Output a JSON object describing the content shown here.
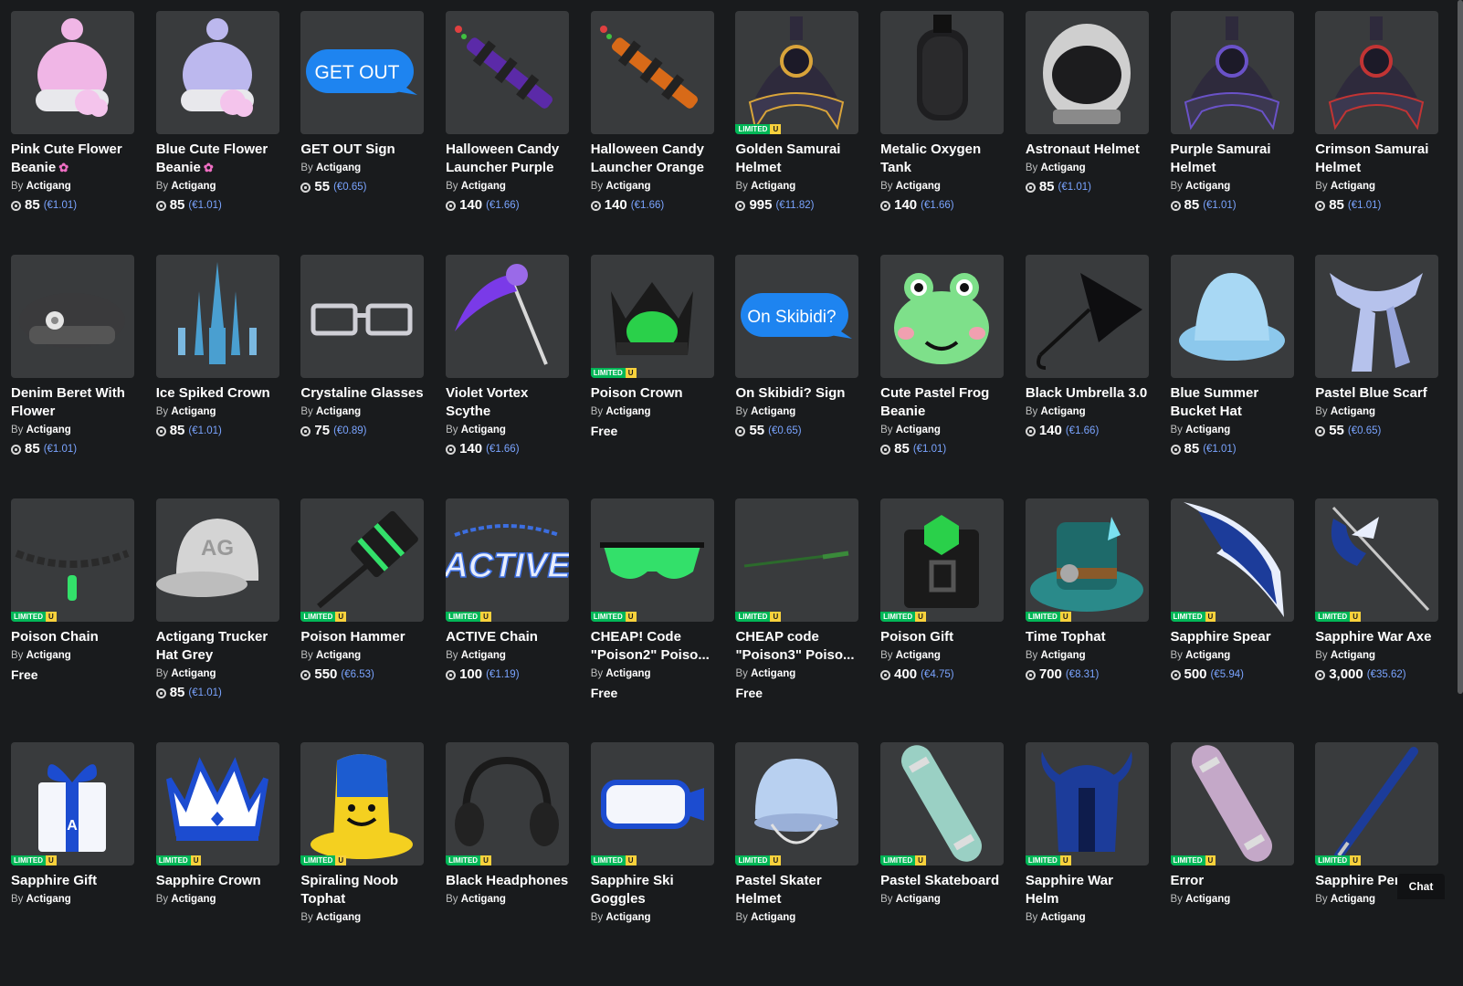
{
  "chat_label": "Chat",
  "creator_prefix": "By",
  "limited_label": "LIMITED",
  "unique_label": "U",
  "rows": [
    [
      {
        "name": "Pink Cute Flower Beanie",
        "flower": true,
        "creator": "Actigang",
        "price": "85",
        "eur": "(€1.01)",
        "limited": false,
        "icon": "pink-beanie-icon",
        "art": "beanie",
        "color": "#f0b6e6"
      },
      {
        "name": "Blue Cute Flower Beanie",
        "flower": true,
        "creator": "Actigang",
        "price": "85",
        "eur": "(€1.01)",
        "limited": false,
        "icon": "blue-beanie-icon",
        "art": "beanie",
        "color": "#bcb8ee"
      },
      {
        "name": "GET OUT Sign",
        "creator": "Actigang",
        "price": "55",
        "eur": "(€0.65)",
        "limited": false,
        "icon": "get-out-sign-icon",
        "art": "bubble",
        "bubble_text": "GET OUT"
      },
      {
        "name": "Halloween Candy Launcher Purple",
        "creator": "Actigang",
        "price": "140",
        "eur": "(€1.66)",
        "limited": false,
        "icon": "purple-launcher-icon",
        "art": "launcher",
        "color": "#5b2aa8"
      },
      {
        "name": "Halloween Candy Launcher Orange",
        "creator": "Actigang",
        "price": "140",
        "eur": "(€1.66)",
        "limited": false,
        "icon": "orange-launcher-icon",
        "art": "launcher",
        "color": "#d86a18"
      },
      {
        "name": "Golden Samurai Helmet",
        "creator": "Actigang",
        "price": "995",
        "eur": "(€11.82)",
        "limited": true,
        "icon": "golden-samurai-helmet-icon",
        "art": "samurai",
        "color": "#d9a43a"
      },
      {
        "name": "Metalic Oxygen Tank",
        "creator": "Actigang",
        "price": "140",
        "eur": "(€1.66)",
        "limited": false,
        "icon": "oxygen-tank-icon",
        "art": "tank",
        "color": "#2a2a2c"
      },
      {
        "name": "Astronaut Helmet",
        "creator": "Actigang",
        "price": "85",
        "eur": "(€1.01)",
        "limited": false,
        "icon": "astronaut-helmet-icon",
        "art": "astronaut",
        "color": "#cfcfcf"
      },
      {
        "name": "Purple Samurai Helmet",
        "creator": "Actigang",
        "price": "85",
        "eur": "(€1.01)",
        "limited": false,
        "icon": "purple-samurai-helmet-icon",
        "art": "samurai",
        "color": "#6a52c8"
      },
      {
        "name": "Crimson Samurai Helmet",
        "creator": "Actigang",
        "price": "85",
        "eur": "(€1.01)",
        "limited": false,
        "icon": "crimson-samurai-helmet-icon",
        "art": "samurai",
        "color": "#c23434"
      }
    ],
    [
      {
        "name": "Denim Beret With Flower",
        "creator": "Actigang",
        "price": "85",
        "eur": "(€1.01)",
        "limited": false,
        "icon": "beret-icon",
        "art": "beret",
        "color": "#3a3a3c"
      },
      {
        "name": "Ice Spiked Crown",
        "creator": "Actigang",
        "price": "85",
        "eur": "(€1.01)",
        "limited": false,
        "icon": "ice-crown-icon",
        "art": "icecrown",
        "color": "#4a9fd0"
      },
      {
        "name": "Crystaline Glasses",
        "creator": "Actigang",
        "price": "75",
        "eur": "(€0.89)",
        "limited": false,
        "icon": "glasses-icon",
        "art": "glasses",
        "color": "#cfcfd6"
      },
      {
        "name": "Violet Vortex Scythe",
        "creator": "Actigang",
        "price": "140",
        "eur": "(€1.66)",
        "limited": false,
        "icon": "scythe-icon",
        "art": "scythe",
        "color": "#7a3ae8"
      },
      {
        "name": "Poison Crown",
        "creator": "Actigang",
        "free": "Free",
        "limited": true,
        "icon": "poison-crown-icon",
        "art": "poisoncrown",
        "color": "#2ad04a"
      },
      {
        "name": "On Skibidi? Sign",
        "creator": "Actigang",
        "price": "55",
        "eur": "(€0.65)",
        "limited": false,
        "icon": "skibidi-sign-icon",
        "art": "bubble",
        "bubble_text": "On Skibidi?"
      },
      {
        "name": "Cute Pastel Frog Beanie",
        "creator": "Actigang",
        "price": "85",
        "eur": "(€1.01)",
        "limited": false,
        "icon": "frog-beanie-icon",
        "art": "frog",
        "color": "#7ee08a"
      },
      {
        "name": "Black Umbrella 3.0",
        "creator": "Actigang",
        "price": "140",
        "eur": "(€1.66)",
        "limited": false,
        "icon": "umbrella-icon",
        "art": "umbrella",
        "color": "#0e0e10"
      },
      {
        "name": "Blue Summer Bucket Hat",
        "creator": "Actigang",
        "price": "85",
        "eur": "(€1.01)",
        "limited": false,
        "icon": "bucket-hat-icon",
        "art": "bucket",
        "color": "#8cc8ec"
      },
      {
        "name": "Pastel Blue Scarf",
        "creator": "Actigang",
        "price": "55",
        "eur": "(€0.65)",
        "limited": false,
        "icon": "scarf-icon",
        "art": "scarf",
        "color": "#b6c2ec"
      }
    ],
    [
      {
        "name": "Poison Chain",
        "creator": "Actigang",
        "free": "Free",
        "limited": true,
        "icon": "poison-chain-icon",
        "art": "chain",
        "color": "#1a1a1a"
      },
      {
        "name": "Actigang Trucker Hat Grey",
        "creator": "Actigang",
        "price": "85",
        "eur": "(€1.01)",
        "limited": false,
        "icon": "trucker-hat-icon",
        "art": "cap",
        "color": "#d4d4d4"
      },
      {
        "name": "Poison Hammer",
        "creator": "Actigang",
        "price": "550",
        "eur": "(€6.53)",
        "limited": true,
        "icon": "poison-hammer-icon",
        "art": "hammer",
        "color": "#1c1c1c"
      },
      {
        "name": "ACTIVE Chain",
        "creator": "Actigang",
        "price": "100",
        "eur": "(€1.19)",
        "limited": true,
        "icon": "active-chain-icon",
        "art": "active",
        "color": "#3c6ee0"
      },
      {
        "name": "CHEAP! Code \"Poison2\" Poiso...",
        "creator": "Actigang",
        "free": "Free",
        "limited": true,
        "icon": "poison-goggles-icon",
        "art": "shades",
        "color": "#33e06a"
      },
      {
        "name": "CHEAP code \"Poison3\" Poiso...",
        "creator": "Actigang",
        "free": "Free",
        "limited": true,
        "icon": "poison-katana-icon",
        "art": "katana",
        "color": "#2c6a2c"
      },
      {
        "name": "Poison Gift",
        "creator": "Actigang",
        "price": "400",
        "eur": "(€4.75)",
        "limited": true,
        "icon": "poison-gift-icon",
        "art": "poisongift",
        "color": "#2ad04a"
      },
      {
        "name": "Time Tophat",
        "creator": "Actigang",
        "price": "700",
        "eur": "(€8.31)",
        "limited": true,
        "icon": "time-tophat-icon",
        "art": "timehat",
        "color": "#2a8a8a"
      },
      {
        "name": "Sapphire Spear",
        "creator": "Actigang",
        "price": "500",
        "eur": "(€5.94)",
        "limited": true,
        "icon": "sapphire-spear-icon",
        "art": "spear",
        "color": "#1c3c9a"
      },
      {
        "name": "Sapphire War Axe",
        "creator": "Actigang",
        "price": "3,000",
        "eur": "(€35.62)",
        "limited": true,
        "icon": "sapphire-axe-icon",
        "art": "axe",
        "color": "#1c3c9a"
      }
    ],
    [
      {
        "name": "Sapphire Gift",
        "creator": "Actigang",
        "limited": true,
        "icon": "sapphire-gift-icon",
        "art": "gift",
        "color": "#1c4cd0"
      },
      {
        "name": "Sapphire Crown",
        "creator": "Actigang",
        "limited": true,
        "icon": "sapphire-crown-icon",
        "art": "crown",
        "color": "#1c4cd0"
      },
      {
        "name": "Spiraling Noob Tophat",
        "creator": "Actigang",
        "limited": true,
        "icon": "noob-tophat-icon",
        "art": "noobhat",
        "color": "#f4d020"
      },
      {
        "name": "Black Headphones",
        "creator": "Actigang",
        "limited": true,
        "icon": "headphones-icon",
        "art": "headphones",
        "color": "#1a1a1a"
      },
      {
        "name": "Sapphire Ski Goggles",
        "creator": "Actigang",
        "limited": true,
        "icon": "ski-goggles-icon",
        "art": "goggles",
        "color": "#1c4cd0"
      },
      {
        "name": "Pastel Skater Helmet",
        "creator": "Actigang",
        "limited": true,
        "icon": "skater-helmet-icon",
        "art": "skatehelmet",
        "color": "#b8d0f0"
      },
      {
        "name": "Pastel Skateboard",
        "creator": "Actigang",
        "limited": true,
        "icon": "skateboard-icon",
        "art": "skateboard",
        "color": "#9ad0c4"
      },
      {
        "name": "Sapphire War Helm",
        "creator": "Actigang",
        "limited": true,
        "icon": "war-helm-icon",
        "art": "warhelm",
        "color": "#1c3c9a"
      },
      {
        "name": "Error",
        "creator": "Actigang",
        "limited": true,
        "icon": "error-skateboard-icon",
        "art": "skateboard",
        "color": "#c4a8c8"
      },
      {
        "name": "Sapphire Pen",
        "creator": "Actigang",
        "limited": true,
        "icon": "sapphire-pen-icon",
        "art": "pen",
        "color": "#1c3c9a"
      }
    ]
  ]
}
